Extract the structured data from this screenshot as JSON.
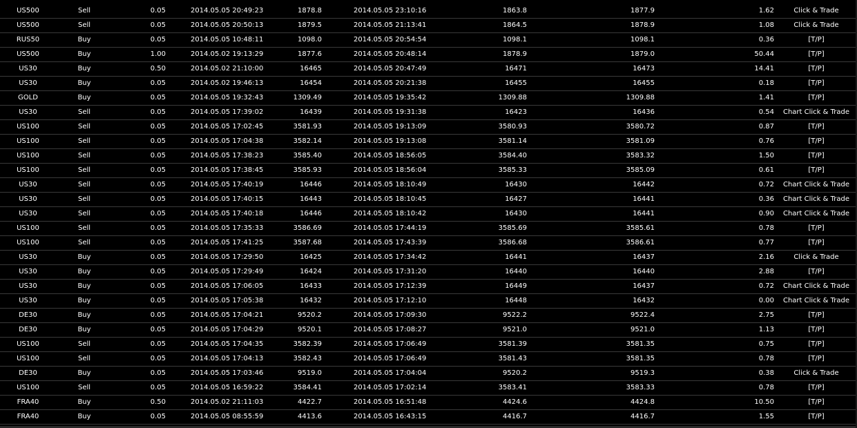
{
  "trades": [
    {
      "symbol": "US500",
      "type": "Sell",
      "volume": "0.05",
      "open_time": "2014.05.05 20:49:23",
      "open_price": "1878.8",
      "close_time": "2014.05.05 23:10:16",
      "close_price": "1863.8",
      "current_price": "1877.9",
      "profit": "1.62",
      "comment": "Click & Trade"
    },
    {
      "symbol": "US500",
      "type": "Sell",
      "volume": "0.05",
      "open_time": "2014.05.05 20:50:13",
      "open_price": "1879.5",
      "close_time": "2014.05.05 21:13:41",
      "close_price": "1864.5",
      "current_price": "1878.9",
      "profit": "1.08",
      "comment": "Click & Trade"
    },
    {
      "symbol": "RUS50",
      "type": "Buy",
      "volume": "0.05",
      "open_time": "2014.05.05 10:48:11",
      "open_price": "1098.0",
      "close_time": "2014.05.05 20:54:54",
      "close_price": "1098.1",
      "current_price": "1098.1",
      "profit": "0.36",
      "comment": "[T/P]"
    },
    {
      "symbol": "US500",
      "type": "Buy",
      "volume": "1.00",
      "open_time": "2014.05.02 19:13:29",
      "open_price": "1877.6",
      "close_time": "2014.05.05 20:48:14",
      "close_price": "1878.9",
      "current_price": "1879.0",
      "profit": "50.44",
      "comment": "[T/P]"
    },
    {
      "symbol": "US30",
      "type": "Buy",
      "volume": "0.50",
      "open_time": "2014.05.02 21:10:00",
      "open_price": "16465",
      "close_time": "2014.05.05 20:47:49",
      "close_price": "16471",
      "current_price": "16473",
      "profit": "14.41",
      "comment": "[T/P]"
    },
    {
      "symbol": "US30",
      "type": "Buy",
      "volume": "0.05",
      "open_time": "2014.05.02 19:46:13",
      "open_price": "16454",
      "close_time": "2014.05.05 20:21:38",
      "close_price": "16455",
      "current_price": "16455",
      "profit": "0.18",
      "comment": "[T/P]"
    },
    {
      "symbol": "GOLD",
      "type": "Buy",
      "volume": "0.05",
      "open_time": "2014.05.05 19:32:43",
      "open_price": "1309.49",
      "close_time": "2014.05.05 19:35:42",
      "close_price": "1309.88",
      "current_price": "1309.88",
      "profit": "1.41",
      "comment": "[T/P]"
    },
    {
      "symbol": "US30",
      "type": "Sell",
      "volume": "0.05",
      "open_time": "2014.05.05 17:39:02",
      "open_price": "16439",
      "close_time": "2014.05.05 19:31:38",
      "close_price": "16423",
      "current_price": "16436",
      "profit": "0.54",
      "comment": "Chart Click & Trade"
    },
    {
      "symbol": "US100",
      "type": "Sell",
      "volume": "0.05",
      "open_time": "2014.05.05 17:02:45",
      "open_price": "3581.93",
      "close_time": "2014.05.05 19:13:09",
      "close_price": "3580.93",
      "current_price": "3580.72",
      "profit": "0.87",
      "comment": "[T/P]"
    },
    {
      "symbol": "US100",
      "type": "Sell",
      "volume": "0.05",
      "open_time": "2014.05.05 17:04:38",
      "open_price": "3582.14",
      "close_time": "2014.05.05 19:13:08",
      "close_price": "3581.14",
      "current_price": "3581.09",
      "profit": "0.76",
      "comment": "[T/P]"
    },
    {
      "symbol": "US100",
      "type": "Sell",
      "volume": "0.05",
      "open_time": "2014.05.05 17:38:23",
      "open_price": "3585.40",
      "close_time": "2014.05.05 18:56:05",
      "close_price": "3584.40",
      "current_price": "3583.32",
      "profit": "1.50",
      "comment": "[T/P]"
    },
    {
      "symbol": "US100",
      "type": "Sell",
      "volume": "0.05",
      "open_time": "2014.05.05 17:38:45",
      "open_price": "3585.93",
      "close_time": "2014.05.05 18:56:04",
      "close_price": "3585.33",
      "current_price": "3585.09",
      "profit": "0.61",
      "comment": "[T/P]"
    },
    {
      "symbol": "US30",
      "type": "Sell",
      "volume": "0.05",
      "open_time": "2014.05.05 17:40:19",
      "open_price": "16446",
      "close_time": "2014.05.05 18:10:49",
      "close_price": "16430",
      "current_price": "16442",
      "profit": "0.72",
      "comment": "Chart Click & Trade"
    },
    {
      "symbol": "US30",
      "type": "Sell",
      "volume": "0.05",
      "open_time": "2014.05.05 17:40:15",
      "open_price": "16443",
      "close_time": "2014.05.05 18:10:45",
      "close_price": "16427",
      "current_price": "16441",
      "profit": "0.36",
      "comment": "Chart Click & Trade"
    },
    {
      "symbol": "US30",
      "type": "Sell",
      "volume": "0.05",
      "open_time": "2014.05.05 17:40:18",
      "open_price": "16446",
      "close_time": "2014.05.05 18:10:42",
      "close_price": "16430",
      "current_price": "16441",
      "profit": "0.90",
      "comment": "Chart Click & Trade"
    },
    {
      "symbol": "US100",
      "type": "Sell",
      "volume": "0.05",
      "open_time": "2014.05.05 17:35:33",
      "open_price": "3586.69",
      "close_time": "2014.05.05 17:44:19",
      "close_price": "3585.69",
      "current_price": "3585.61",
      "profit": "0.78",
      "comment": "[T/P]"
    },
    {
      "symbol": "US100",
      "type": "Sell",
      "volume": "0.05",
      "open_time": "2014.05.05 17:41:25",
      "open_price": "3587.68",
      "close_time": "2014.05.05 17:43:39",
      "close_price": "3586.68",
      "current_price": "3586.61",
      "profit": "0.77",
      "comment": "[T/P]"
    },
    {
      "symbol": "US30",
      "type": "Buy",
      "volume": "0.05",
      "open_time": "2014.05.05 17:29:50",
      "open_price": "16425",
      "close_time": "2014.05.05 17:34:42",
      "close_price": "16441",
      "current_price": "16437",
      "profit": "2.16",
      "comment": "Click & Trade"
    },
    {
      "symbol": "US30",
      "type": "Buy",
      "volume": "0.05",
      "open_time": "2014.05.05 17:29:49",
      "open_price": "16424",
      "close_time": "2014.05.05 17:31:20",
      "close_price": "16440",
      "current_price": "16440",
      "profit": "2.88",
      "comment": "[T/P]"
    },
    {
      "symbol": "US30",
      "type": "Buy",
      "volume": "0.05",
      "open_time": "2014.05.05 17:06:05",
      "open_price": "16433",
      "close_time": "2014.05.05 17:12:39",
      "close_price": "16449",
      "current_price": "16437",
      "profit": "0.72",
      "comment": "Chart Click & Trade"
    },
    {
      "symbol": "US30",
      "type": "Buy",
      "volume": "0.05",
      "open_time": "2014.05.05 17:05:38",
      "open_price": "16432",
      "close_time": "2014.05.05 17:12:10",
      "close_price": "16448",
      "current_price": "16432",
      "profit": "0.00",
      "comment": "Chart Click & Trade"
    },
    {
      "symbol": "DE30",
      "type": "Buy",
      "volume": "0.05",
      "open_time": "2014.05.05 17:04:21",
      "open_price": "9520.2",
      "close_time": "2014.05.05 17:09:30",
      "close_price": "9522.2",
      "current_price": "9522.4",
      "profit": "2.75",
      "comment": "[T/P]"
    },
    {
      "symbol": "DE30",
      "type": "Buy",
      "volume": "0.05",
      "open_time": "2014.05.05 17:04:29",
      "open_price": "9520.1",
      "close_time": "2014.05.05 17:08:27",
      "close_price": "9521.0",
      "current_price": "9521.0",
      "profit": "1.13",
      "comment": "[T/P]"
    },
    {
      "symbol": "US100",
      "type": "Sell",
      "volume": "0.05",
      "open_time": "2014.05.05 17:04:35",
      "open_price": "3582.39",
      "close_time": "2014.05.05 17:06:49",
      "close_price": "3581.39",
      "current_price": "3581.35",
      "profit": "0.75",
      "comment": "[T/P]"
    },
    {
      "symbol": "US100",
      "type": "Sell",
      "volume": "0.05",
      "open_time": "2014.05.05 17:04:13",
      "open_price": "3582.43",
      "close_time": "2014.05.05 17:06:49",
      "close_price": "3581.43",
      "current_price": "3581.35",
      "profit": "0.78",
      "comment": "[T/P]"
    },
    {
      "symbol": "DE30",
      "type": "Buy",
      "volume": "0.05",
      "open_time": "2014.05.05 17:03:46",
      "open_price": "9519.0",
      "close_time": "2014.05.05 17:04:04",
      "close_price": "9520.2",
      "current_price": "9519.3",
      "profit": "0.38",
      "comment": "Click & Trade"
    },
    {
      "symbol": "US100",
      "type": "Sell",
      "volume": "0.05",
      "open_time": "2014.05.05 16:59:22",
      "open_price": "3584.41",
      "close_time": "2014.05.05 17:02:14",
      "close_price": "3583.41",
      "current_price": "3583.33",
      "profit": "0.78",
      "comment": "[T/P]"
    },
    {
      "symbol": "FRA40",
      "type": "Buy",
      "volume": "0.50",
      "open_time": "2014.05.02 21:11:03",
      "open_price": "4422.7",
      "close_time": "2014.05.05 16:51:48",
      "close_price": "4424.6",
      "current_price": "4424.8",
      "profit": "10.50",
      "comment": "[T/P]"
    },
    {
      "symbol": "FRA40",
      "type": "Buy",
      "volume": "0.05",
      "open_time": "2014.05.05 08:55:59",
      "open_price": "4413.6",
      "close_time": "2014.05.05 16:43:15",
      "close_price": "4416.7",
      "current_price": "4416.7",
      "profit": "1.55",
      "comment": "[T/P]"
    }
  ],
  "colors": {
    "background": "#000000",
    "text": "#ffffff",
    "row_divider": "#3a3a3a"
  }
}
